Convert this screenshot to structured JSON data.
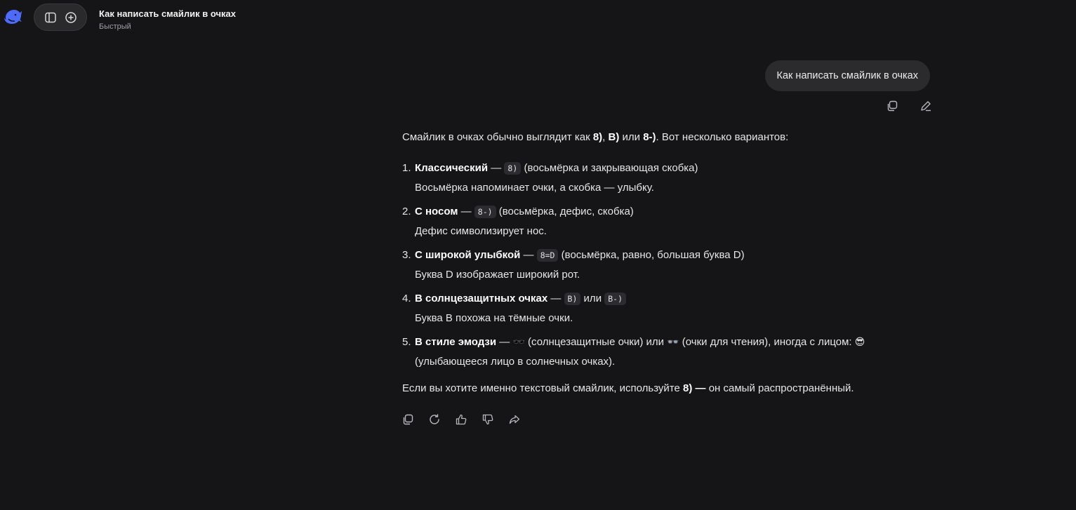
{
  "header": {
    "title": "Как написать смайлик в очках",
    "mode": "Быстрый"
  },
  "user_message": "Как написать смайлик в очках",
  "answer": {
    "intro_prefix": "Смайлик в очках обычно выглядит как ",
    "intro_code1": "8)",
    "intro_sep1": ", ",
    "intro_code2": "B)",
    "intro_sep2": " или ",
    "intro_code3": "8-)",
    "intro_suffix": ". Вот несколько вариантов:",
    "items": [
      {
        "num": "1.",
        "title": "Классический",
        "dash": " — ",
        "code": "8)",
        "desc": " (восьмёрка и закрывающая скобка)",
        "note": "Восьмёрка напоминает очки, а скобка — улыбку."
      },
      {
        "num": "2.",
        "title": "С носом",
        "dash": " — ",
        "code": "8-)",
        "desc": " (восьмёрка, дефис, скобка)",
        "note": "Дефис символизирует нос."
      },
      {
        "num": "3.",
        "title": "С широкой улыбкой",
        "dash": " — ",
        "code": "8=D",
        "desc": " (восьмёрка, равно, большая буква D)",
        "note": "Буква D изображает широкий рот."
      },
      {
        "num": "4.",
        "title": "В солнцезащитных очках",
        "dash": " — ",
        "code": "B)",
        "mid": " или ",
        "code2": "B-)",
        "note": "Буква B похожа на тёмные очки."
      },
      {
        "num": "5.",
        "title": "В стиле эмодзи",
        "dash": " — ",
        "emoji1": "🕶️",
        "text1": " (солнцезащитные очки) или ",
        "emoji2": "👓",
        "text2": " (очки для чтения), иногда с лицом: ",
        "emoji3": "😎",
        "text3": "(улыбающееся лицо в солнечных очках)."
      }
    ],
    "outro_prefix": "Если вы хотите именно текстовый смайлик, используйте ",
    "outro_bold": "8) —",
    "outro_suffix": " он самый распространённый."
  },
  "icons": {
    "logo": "whale-logo-icon",
    "sidebar": "sidebar-toggle-icon",
    "new_chat": "new-chat-icon",
    "copy": "copy-icon",
    "edit": "edit-icon",
    "regenerate": "regenerate-icon",
    "like": "thumbs-up-icon",
    "dislike": "thumbs-down-icon",
    "share": "share-icon"
  },
  "colors": {
    "background": "#151517",
    "bubble": "#2b2b2e",
    "accent": "#4d6bfe"
  }
}
